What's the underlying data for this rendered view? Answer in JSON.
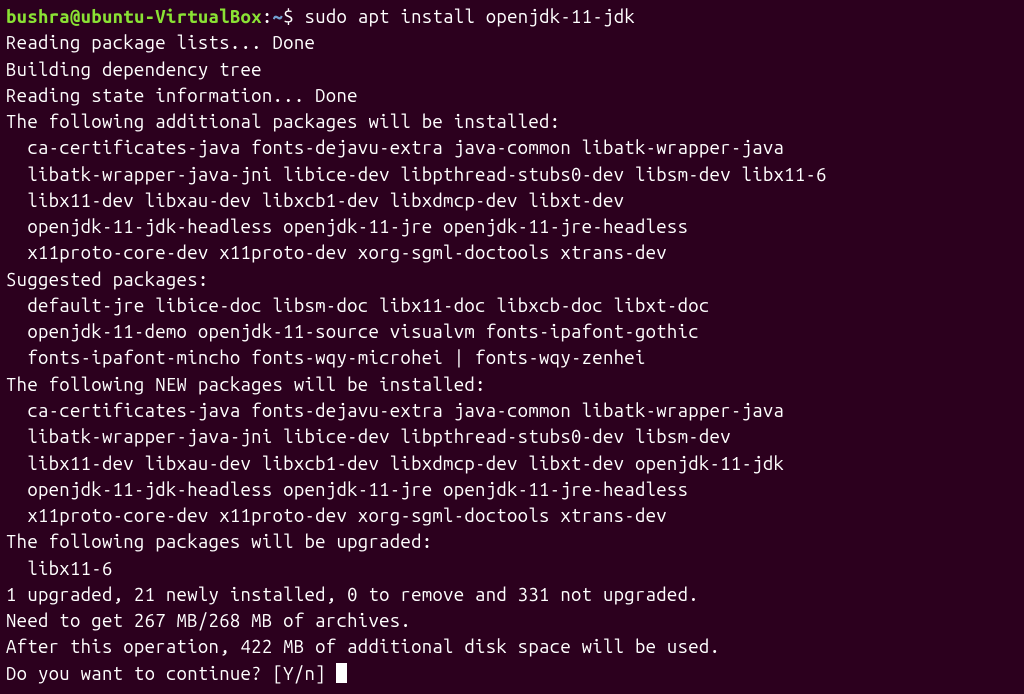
{
  "prompt": {
    "user": "bushra",
    "at": "@",
    "host": "ubuntu-VirtualBox",
    "separator": ":",
    "path": "~",
    "dollar": "$ ",
    "command": "sudo apt install openjdk-11-jdk"
  },
  "output": {
    "line1": "Reading package lists... Done",
    "line2": "Building dependency tree",
    "line3": "Reading state information... Done",
    "line4": "The following additional packages will be installed:",
    "line5": "  ca-certificates-java fonts-dejavu-extra java-common libatk-wrapper-java",
    "line6": "  libatk-wrapper-java-jni libice-dev libpthread-stubs0-dev libsm-dev libx11-6",
    "line7": "  libx11-dev libxau-dev libxcb1-dev libxdmcp-dev libxt-dev",
    "line8": "  openjdk-11-jdk-headless openjdk-11-jre openjdk-11-jre-headless",
    "line9": "  x11proto-core-dev x11proto-dev xorg-sgml-doctools xtrans-dev",
    "line10": "Suggested packages:",
    "line11": "  default-jre libice-doc libsm-doc libx11-doc libxcb-doc libxt-doc",
    "line12": "  openjdk-11-demo openjdk-11-source visualvm fonts-ipafont-gothic",
    "line13": "  fonts-ipafont-mincho fonts-wqy-microhei | fonts-wqy-zenhei",
    "line14": "The following NEW packages will be installed:",
    "line15": "  ca-certificates-java fonts-dejavu-extra java-common libatk-wrapper-java",
    "line16": "  libatk-wrapper-java-jni libice-dev libpthread-stubs0-dev libsm-dev",
    "line17": "  libx11-dev libxau-dev libxcb1-dev libxdmcp-dev libxt-dev openjdk-11-jdk",
    "line18": "  openjdk-11-jdk-headless openjdk-11-jre openjdk-11-jre-headless",
    "line19": "  x11proto-core-dev x11proto-dev xorg-sgml-doctools xtrans-dev",
    "line20": "The following packages will be upgraded:",
    "line21": "  libx11-6",
    "line22": "1 upgraded, 21 newly installed, 0 to remove and 331 not upgraded.",
    "line23": "Need to get 267 MB/268 MB of archives.",
    "line24": "After this operation, 422 MB of additional disk space will be used.",
    "line25": "Do you want to continue? [Y/n] "
  }
}
